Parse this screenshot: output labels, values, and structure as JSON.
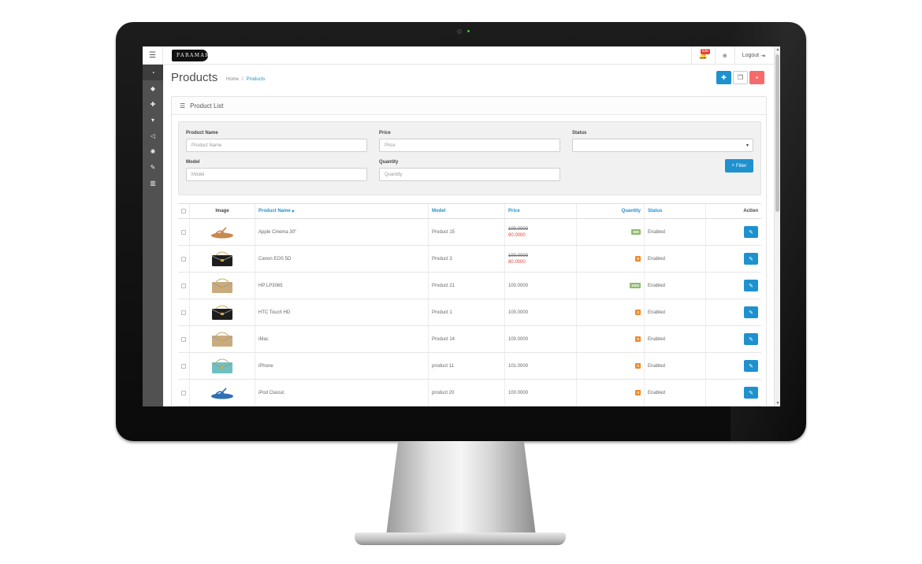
{
  "header": {
    "logo_text": "FARAMAR",
    "notification_count": "530",
    "logout_label": "Logout"
  },
  "sidebar": {
    "items": [
      {
        "icon": "dashboard-icon"
      },
      {
        "icon": "tags-icon"
      },
      {
        "icon": "puzzle-icon"
      },
      {
        "icon": "cart-icon"
      },
      {
        "icon": "share-icon"
      },
      {
        "icon": "gear-icon"
      },
      {
        "icon": "wrench-icon"
      },
      {
        "icon": "bar-chart-icon"
      }
    ]
  },
  "page": {
    "title": "Products",
    "breadcrumb": [
      "Home",
      "/",
      "Products"
    ]
  },
  "panel": {
    "title": "Product List"
  },
  "filter": {
    "product_name_label": "Product Name",
    "product_name_placeholder": "Product Name",
    "price_label": "Price",
    "price_placeholder": "Price",
    "status_label": "Status",
    "status_value": "",
    "model_label": "Model",
    "model_placeholder": "Model",
    "quantity_label": "Quantity",
    "quantity_placeholder": "Quantity",
    "filter_button": "Filter"
  },
  "table": {
    "columns": [
      "Image",
      "Product Name",
      "Model",
      "Price",
      "Quantity",
      "Status",
      "Action"
    ],
    "sort_indicator": "▾",
    "rows": [
      {
        "name": "Apple Cinema 30\"",
        "model": "Product 15",
        "price": "100.0000",
        "special": "90.0000",
        "qty": "990",
        "qty_state": "ok",
        "status": "Enabled",
        "thumb": "sandal",
        "thumb_color": "#c8894e"
      },
      {
        "name": "Canon EOS 5D",
        "model": "Product 3",
        "price": "100.0000",
        "special": "80.0000",
        "qty": "0",
        "qty_state": "low",
        "status": "Enabled",
        "thumb": "bag",
        "thumb_color": "#1e1e1e"
      },
      {
        "name": "HP LP3065",
        "model": "Product 21",
        "price": "100.0000",
        "special": "",
        "qty": "1000",
        "qty_state": "ok",
        "status": "Enabled",
        "thumb": "bag",
        "thumb_color": "#c9ab7f"
      },
      {
        "name": "HTC Touch HD",
        "model": "Product 1",
        "price": "100.0000",
        "special": "",
        "qty": "0",
        "qty_state": "low",
        "status": "Enabled",
        "thumb": "bag",
        "thumb_color": "#1e1e1e"
      },
      {
        "name": "iMac",
        "model": "Product 14",
        "price": "100.0000",
        "special": "",
        "qty": "0",
        "qty_state": "low",
        "status": "Enabled",
        "thumb": "bag",
        "thumb_color": "#c9ab7f"
      },
      {
        "name": "iPhone",
        "model": "product 11",
        "price": "101.0000",
        "special": "",
        "qty": "0",
        "qty_state": "low",
        "status": "Enabled",
        "thumb": "bag",
        "thumb_color": "#6fc0c0"
      },
      {
        "name": "iPod Classic",
        "model": "product 20",
        "price": "100.0000",
        "special": "",
        "qty": "0",
        "qty_state": "low",
        "status": "Enabled",
        "thumb": "sandal",
        "thumb_color": "#2f6fb3"
      }
    ]
  },
  "colors": {
    "primary": "#1e91cf",
    "danger": "#f56b6b",
    "sidebar": "#515151",
    "qty_ok": "#8fbb6c",
    "qty_low": "#f0892b",
    "special_price": "#e2433a"
  }
}
